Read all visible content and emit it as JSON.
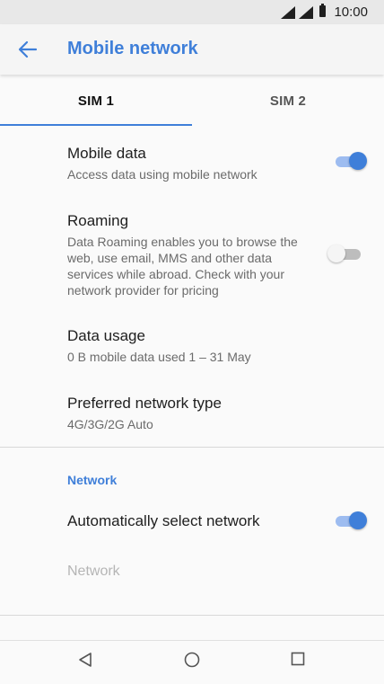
{
  "status_bar": {
    "time": "10:00",
    "icons": [
      "signal-icon",
      "signal-icon",
      "battery-icon"
    ]
  },
  "app_bar": {
    "title": "Mobile network",
    "back_icon": "arrow-left-icon"
  },
  "tabs": [
    {
      "label": "SIM 1",
      "selected": true
    },
    {
      "label": "SIM 2",
      "selected": false
    }
  ],
  "settings": {
    "mobile_data": {
      "title": "Mobile data",
      "summary": "Access data using mobile network",
      "enabled": true
    },
    "roaming": {
      "title": "Roaming",
      "summary": "Data Roaming enables you to browse the web, use email, MMS and other data services while abroad. Check with your network provider for pricing",
      "enabled": false
    },
    "data_usage": {
      "title": "Data usage",
      "summary": "0 B mobile data used 1 – 31 May"
    },
    "preferred_network": {
      "title": "Preferred network type",
      "summary": "4G/3G/2G Auto"
    }
  },
  "network_section": {
    "header": "Network",
    "auto_select": {
      "title": "Automatically select network",
      "enabled": true
    },
    "network_item": {
      "title": "Network",
      "disabled": true
    }
  },
  "colors": {
    "accent": "#3f7fd9",
    "toggle_track_on": "#9dbcf0"
  },
  "nav_bar": {
    "icons": [
      "back-triangle-icon",
      "home-circle-icon",
      "recents-square-icon"
    ]
  }
}
